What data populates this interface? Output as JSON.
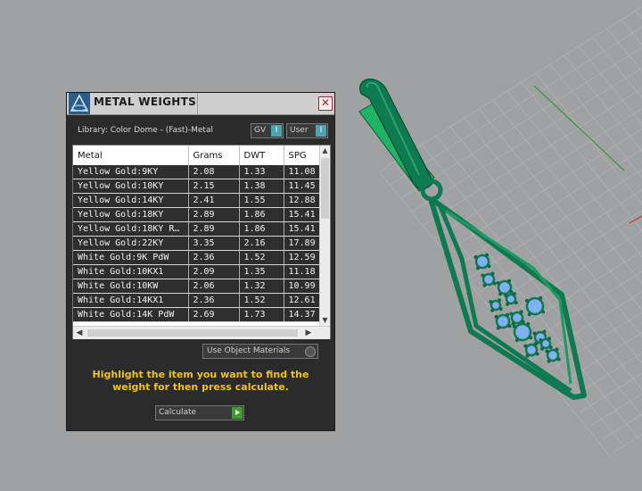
{
  "panel": {
    "title": "METAL WEIGHTS",
    "close_glyph": "✕",
    "library_label": "Library: Color Dome - (Fast)-Metal",
    "toggles": [
      {
        "label": "GV",
        "knob": "I"
      },
      {
        "label": "User",
        "knob": "I"
      }
    ],
    "table": {
      "columns": [
        "Metal",
        "Grams",
        "DWT",
        "SPG"
      ],
      "rows": [
        [
          "Yellow Gold:9KY",
          "2.08",
          "1.33",
          "11.08"
        ],
        [
          "Yellow Gold:10KY",
          "2.15",
          "1.38",
          "11.45"
        ],
        [
          "Yellow Gold:14KY",
          "2.41",
          "1.55",
          "12.88"
        ],
        [
          "Yellow Gold:18KY",
          "2.89",
          "1.86",
          "15.41"
        ],
        [
          "Yellow Gold:18KY R…",
          "2.89",
          "1.86",
          "15.41"
        ],
        [
          "Yellow Gold:22KY",
          "3.35",
          "2.16",
          "17.89"
        ],
        [
          "White Gold:9K PdW",
          "2.36",
          "1.52",
          "12.59"
        ],
        [
          "White Gold:10KX1",
          "2.09",
          "1.35",
          "11.18"
        ],
        [
          "White Gold:10KW",
          "2.06",
          "1.32",
          "10.99"
        ],
        [
          "White Gold:14KX1",
          "2.36",
          "1.52",
          "12.61"
        ],
        [
          "White Gold:14K PdW",
          "2.69",
          "1.73",
          "14.37"
        ]
      ]
    },
    "use_object_label": "Use Object Materials",
    "hint": "Highlight the item you want to find the weight for then press calculate.",
    "calculate_label": "Calculate"
  },
  "icons": [
    "app-logo-icon",
    "close-icon",
    "scroll-up-icon",
    "scroll-down-icon",
    "scroll-left-icon",
    "scroll-right-icon",
    "play-icon",
    "radio-icon"
  ],
  "colors": {
    "panel_bg": "#2b2b2b",
    "hint_text": "#f2c31a",
    "toggle_knob": "#4fa3b0",
    "calc_button": "#3aa02a",
    "model_green": "#0f7a52",
    "gem_blue": "#7fb0f0"
  }
}
